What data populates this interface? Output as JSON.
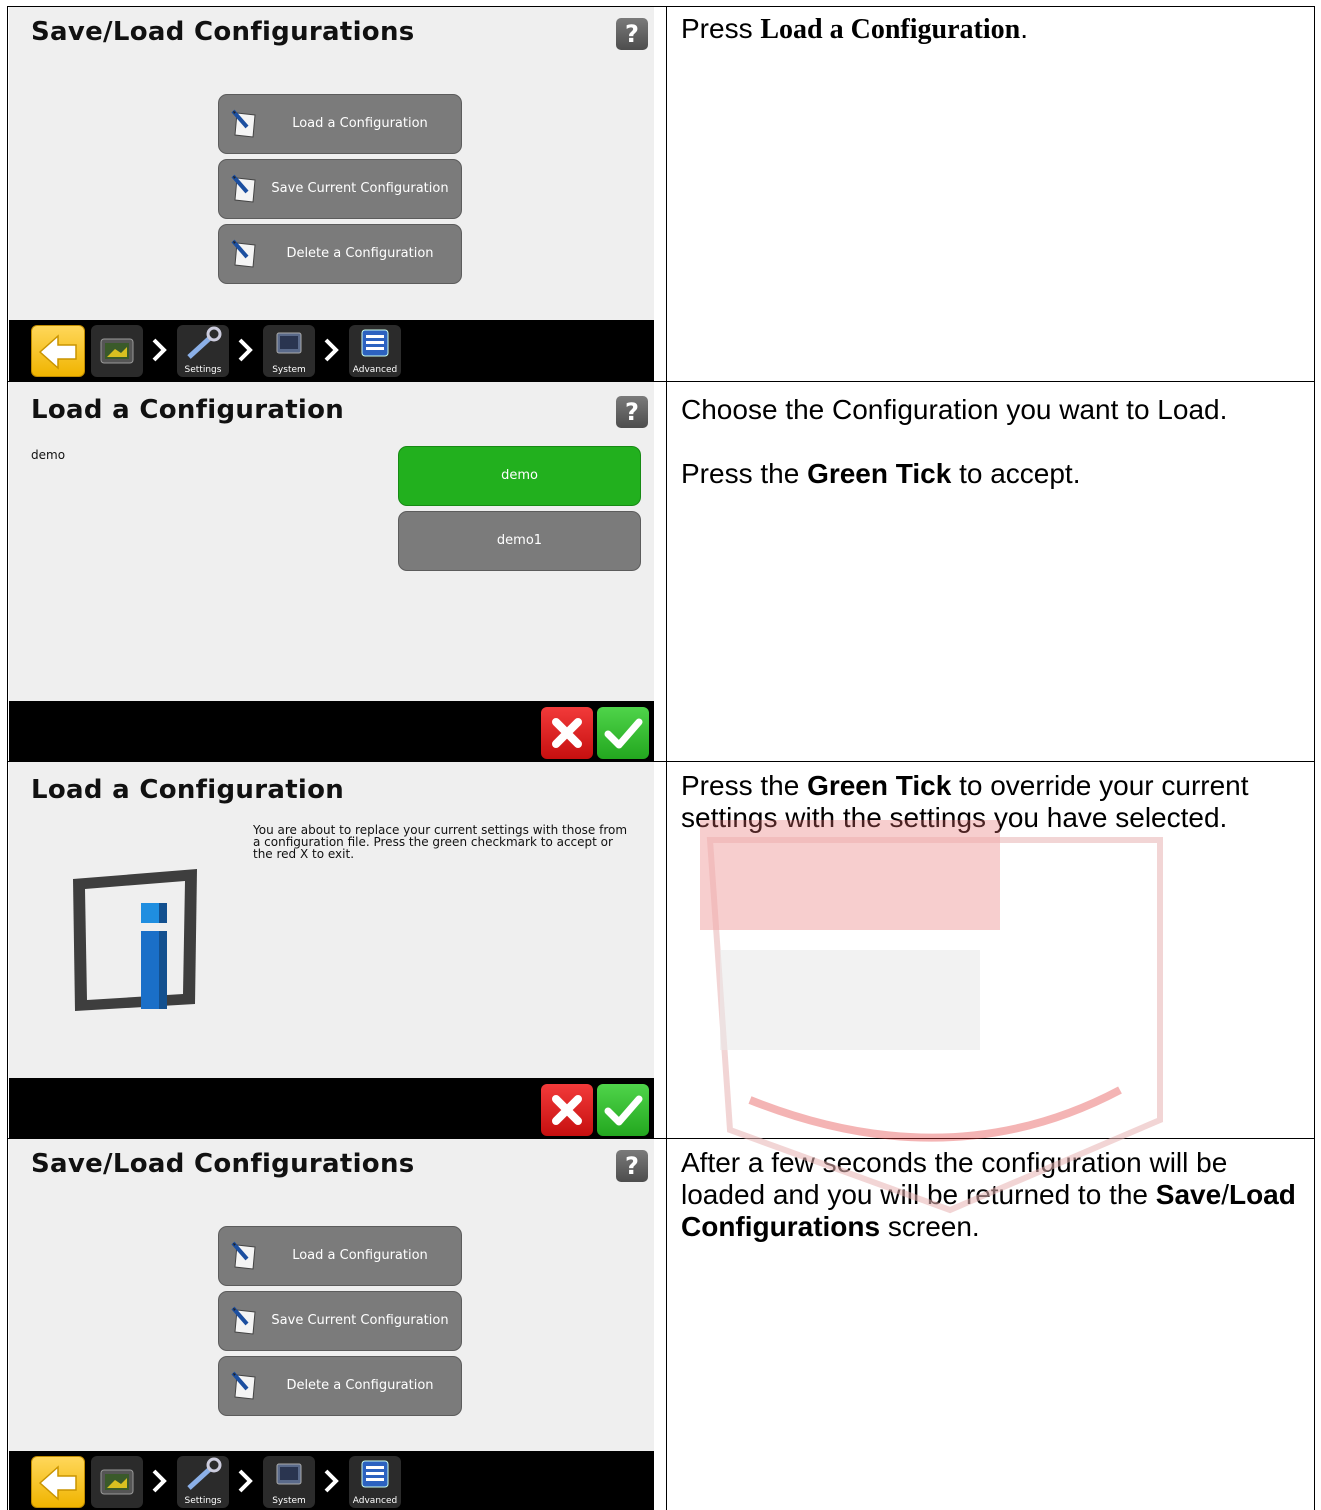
{
  "rows": [
    {
      "screen": {
        "title": "Save/Load Configurations",
        "help_icon": "?",
        "buttons": [
          "Load a Configuration",
          "Save Current Configuration",
          "Delete a Configuration"
        ],
        "nav": {
          "crumbs": [
            "Settings",
            "System",
            "Advanced"
          ]
        }
      },
      "instruction": {
        "prefix": "Press ",
        "bold": "Load a Configuration",
        "suffix": "."
      }
    },
    {
      "screen": {
        "title": "Load a Configuration",
        "help_icon": "?",
        "current_label": "demo",
        "options": [
          {
            "label": "demo",
            "selected": true
          },
          {
            "label": "demo1",
            "selected": false
          }
        ]
      },
      "instruction": {
        "line1": "Choose the Configuration you want to Load.",
        "line2_prefix": "Press the ",
        "line2_bold": "Green Tick",
        "line2_suffix": " to accept."
      }
    },
    {
      "screen": {
        "title": "Load a Configuration",
        "message": "You are about to replace your current settings with those from a configuration file. Press the green checkmark to accept or the red X to exit."
      },
      "instruction": {
        "prefix": "Press the ",
        "bold": "Green Tick",
        "suffix": " to override your current settings with the settings you have selected."
      }
    },
    {
      "screen": {
        "title": "Save/Load Configurations",
        "help_icon": "?",
        "buttons": [
          "Load a Configuration",
          "Save Current Configuration",
          "Delete a Configuration"
        ],
        "nav": {
          "crumbs": [
            "Settings",
            "System",
            "Advanced"
          ]
        }
      },
      "instruction": {
        "prefix": "After a few seconds the configuration will be loaded and you will be returned to the ",
        "bold1": "Save",
        "slash": "/",
        "bold2": "Load Configurations",
        "suffix": " screen."
      }
    }
  ],
  "colors": {
    "selected": "#22b01e",
    "accept": "#34c22f",
    "cancel": "#dd2222",
    "back": "#f5c21b",
    "watermark": "#e23c3c"
  },
  "icons": [
    "help-icon",
    "document-pen-icon",
    "back-arrow-icon",
    "display-icon",
    "wrench-icon",
    "monitor-icon",
    "list-icon",
    "chevron-right-icon",
    "x-icon",
    "checkmark-icon",
    "info-icon"
  ]
}
